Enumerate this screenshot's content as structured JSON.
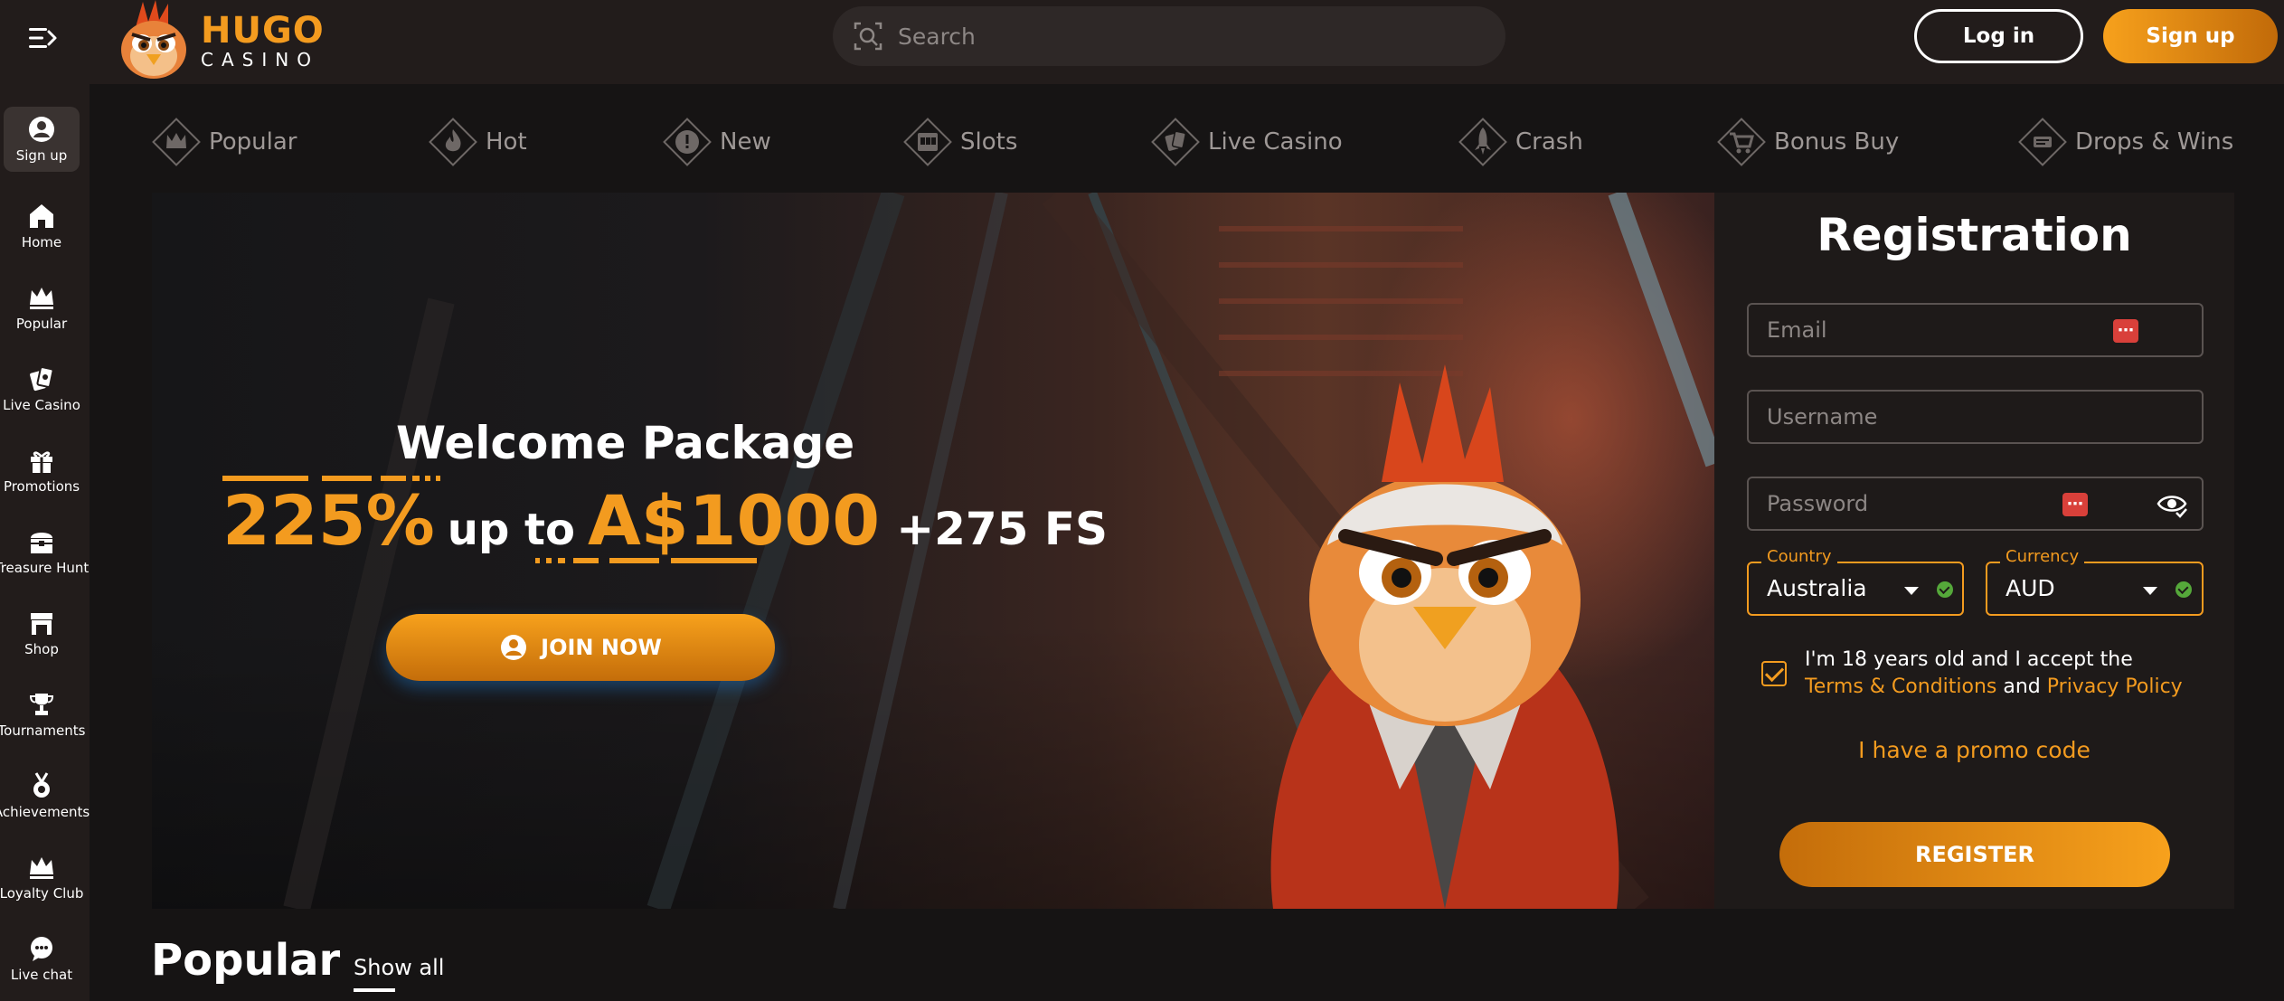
{
  "header": {
    "logo_main": "HUGO",
    "logo_sub": "CASINO",
    "search_placeholder": "Search",
    "login_label": "Log in",
    "signup_label": "Sign up"
  },
  "sidebar": {
    "items": [
      {
        "label": "Sign up",
        "icon": "user-circle-icon"
      },
      {
        "label": "Home",
        "icon": "home-icon"
      },
      {
        "label": "Popular",
        "icon": "crown-icon"
      },
      {
        "label": "Live Casino",
        "icon": "cards-icon"
      },
      {
        "label": "Promotions",
        "icon": "gift-icon"
      },
      {
        "label": "Treasure Hunt",
        "icon": "chest-icon"
      },
      {
        "label": "Shop",
        "icon": "shop-icon"
      },
      {
        "label": "Tournaments",
        "icon": "trophy-icon"
      },
      {
        "label": "Achievements",
        "icon": "medal-icon"
      },
      {
        "label": "Loyalty Club",
        "icon": "crown-icon"
      },
      {
        "label": "Live chat",
        "icon": "chat-icon"
      }
    ]
  },
  "categories": [
    {
      "label": "Popular",
      "icon": "crown-icon"
    },
    {
      "label": "Hot",
      "icon": "flame-icon"
    },
    {
      "label": "New",
      "icon": "exclamation-icon"
    },
    {
      "label": "Slots",
      "icon": "slot-machine-icon"
    },
    {
      "label": "Live Casino",
      "icon": "cards-icon"
    },
    {
      "label": "Crash",
      "icon": "rocket-icon"
    },
    {
      "label": "Bonus Buy",
      "icon": "cart-icon"
    },
    {
      "label": "Drops & Wins",
      "icon": "drops-wins-icon"
    }
  ],
  "hero": {
    "title": "Welcome Package",
    "percent": "225%",
    "up_to": "up to",
    "amount": "A$1000",
    "free_spins": "+275 FS",
    "join_label": "JOIN NOW"
  },
  "registration": {
    "title": "Registration",
    "email_placeholder": "Email",
    "username_placeholder": "Username",
    "password_placeholder": "Password",
    "country_label": "Country",
    "country_value": "Australia",
    "currency_label": "Currency",
    "currency_value": "AUD",
    "agree_prefix": "I'm 18 years old and I accept the",
    "terms_link": "Terms & Conditions",
    "agree_and": "and",
    "privacy_link": "Privacy Policy",
    "promo_link": "I have a promo code",
    "register_label": "REGISTER"
  },
  "section": {
    "title": "Popular",
    "show_all": "Show all"
  },
  "colors": {
    "accent": "#f39b1f",
    "background": "#161414",
    "panel": "#221c1b",
    "badge_red": "#d9403a",
    "ok_green": "#55a83a"
  }
}
